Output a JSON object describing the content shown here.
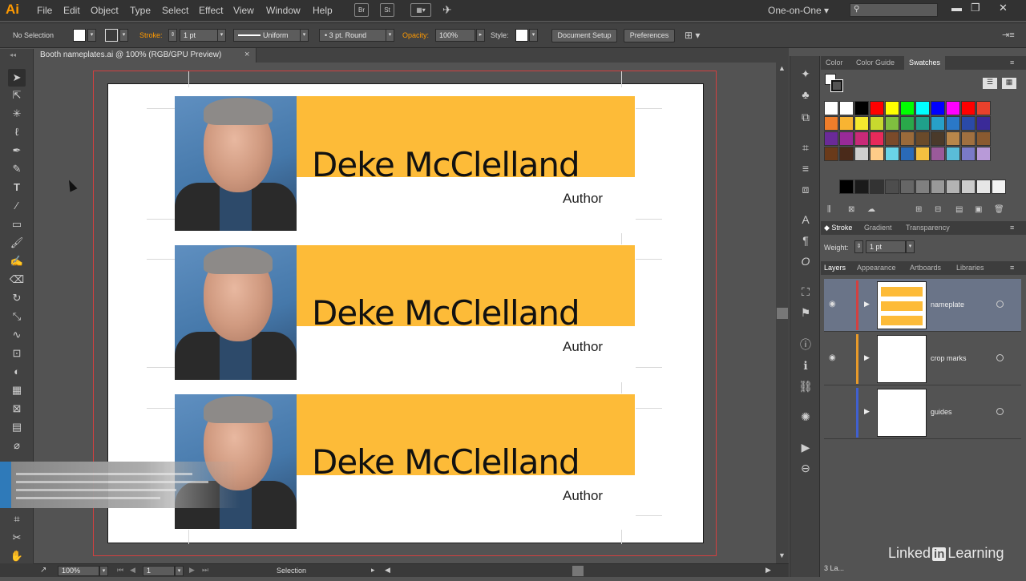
{
  "app": {
    "logo": "Ai",
    "workspace": "One-on-One",
    "menu": [
      "File",
      "Edit",
      "Object",
      "Type",
      "Select",
      "Effect",
      "View",
      "Window",
      "Help"
    ],
    "menu_buttons": [
      "Br",
      "St"
    ]
  },
  "control_bar": {
    "selection": "No Selection",
    "stroke_label": "Stroke:",
    "stroke_weight": "1 pt",
    "profile": "Uniform",
    "brush": "3 pt. Round",
    "opacity_label": "Opacity:",
    "opacity": "100%",
    "style_label": "Style:",
    "document_setup": "Document Setup",
    "preferences": "Preferences"
  },
  "document": {
    "tab_title": "Booth nameplates.ai @ 100% (RGB/GPU Preview)"
  },
  "nameplates": [
    {
      "name": "Deke McClelland",
      "role": "Author"
    },
    {
      "name": "Deke McClelland",
      "role": "Author"
    },
    {
      "name": "Deke McClelland",
      "role": "Author"
    }
  ],
  "status_bar": {
    "zoom": "100%",
    "artboard": "1",
    "tool": "Selection"
  },
  "panels": {
    "swatch_tabs": [
      "Color",
      "Color Guide",
      "Swatches"
    ],
    "stroke_tabs": [
      "Stroke",
      "Gradient",
      "Transparency"
    ],
    "weight_label": "Weight:",
    "weight": "1 pt",
    "layer_tabs": [
      "Layers",
      "Appearance",
      "Artboards",
      "Libraries"
    ],
    "layers": [
      {
        "name": "nameplate",
        "color": "#d24040"
      },
      {
        "name": "crop marks",
        "color": "#e89a2a"
      },
      {
        "name": "guides",
        "color": "#4060d0"
      }
    ],
    "layers_count": "3 La..."
  },
  "swatch_colors": [
    "#ffffff",
    "#ffffff",
    "#000000",
    "#ff0000",
    "#ffff00",
    "#00ff00",
    "#00ffff",
    "#0000ff",
    "#ff00ff",
    "#ff0000",
    "#e8412c",
    "#ef7d2a",
    "#f8b432",
    "#f5e92e",
    "#c8d92e",
    "#7fbf3f",
    "#2aa84a",
    "#1fa08a",
    "#27a0c8",
    "#2a78c8",
    "#2a4aa8",
    "#3a2a98",
    "#6a2a98",
    "#982a98",
    "#c82a78",
    "#e82a5a",
    "#7a4a2a",
    "#9a6a3a",
    "#6a4a2a",
    "#4a3a2a",
    "#b8864a",
    "#a07040",
    "#8a5a30",
    "#6a3a1a",
    "#4a2a1a",
    "#cfcfcf",
    "#ffcc88",
    "#6ad4e8",
    "#2a6ab8",
    "#f4c040",
    "#9a5a9a",
    "#5abcd8",
    "#7a7ac8",
    "#b89ad8"
  ],
  "gray_swatches": [
    "#000000",
    "#1a1a1a",
    "#333333",
    "#4d4d4d",
    "#666666",
    "#808080",
    "#999999",
    "#b3b3b3",
    "#cccccc",
    "#e6e6e6",
    "#f2f2f2"
  ],
  "watermark": {
    "pre": "Linked",
    "in": "in",
    "post": "Learning"
  }
}
